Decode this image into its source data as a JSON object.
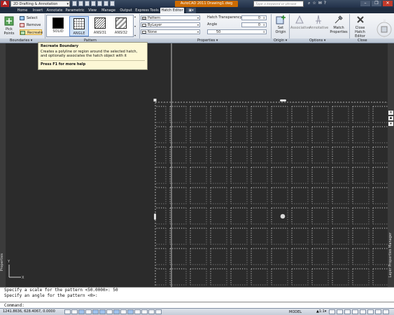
{
  "titlebar": {
    "workspace": "2D Drafting & Annotation",
    "window_title": "AutoCAD 2011   Drawing1.dwg",
    "search_placeholder": "Type a keyword or phrase"
  },
  "tabs": [
    "Home",
    "Insert",
    "Annotate",
    "Parametric",
    "View",
    "Manage",
    "Output",
    "Express Tools",
    "Hatch Editor"
  ],
  "active_tab": "Hatch Editor",
  "boundaries": {
    "pick_points": "Pick Points",
    "select": "Select",
    "remove": "Remove",
    "recreate": "Recreate",
    "panel_label": "Boundaries"
  },
  "pattern": {
    "items": [
      "SOLID",
      "ANGLE",
      "ANSI31",
      "ANSI32"
    ],
    "selected": "ANGLE",
    "panel_label": "Pattern"
  },
  "properties": {
    "hatch_type": "Pattern",
    "color": "ByLayer",
    "background": "None",
    "transparency_label": "Hatch Transparency",
    "transparency_value": "0",
    "angle_label": "Angle",
    "angle_value": "0",
    "scale_value": "50",
    "panel_label": "Properties"
  },
  "origin": {
    "set_origin": "Set Origin",
    "panel_label": "Origin"
  },
  "options": {
    "associative": "Associative",
    "annotative": "Annotative",
    "match_properties": "Match Properties",
    "panel_label": "Options"
  },
  "close": {
    "close_editor": "Close Hatch Editor",
    "panel_label": "Close"
  },
  "tooltip": {
    "title": "Recreate Boundary",
    "body": "Creates a polyline or region around the selected hatch, and optionally associates the hatch object with it",
    "help": "Press F1 for more help"
  },
  "palettes": {
    "left": "Properties",
    "right": "Layer Properties Manager"
  },
  "command": {
    "history": [
      "Specify a scale for the pattern <50.0000>: 50",
      "Specify an angle for the pattern <0>:"
    ],
    "prompt": "Command:"
  },
  "statusbar": {
    "coords": "1241.8636, 628.4067, 0.0000",
    "model": "MODEL",
    "scale": "1:1"
  },
  "colors": {
    "canvas": "#2b2b2b",
    "accent_title": "#cc6b00",
    "hatch_dots": "#d0d0d0"
  }
}
